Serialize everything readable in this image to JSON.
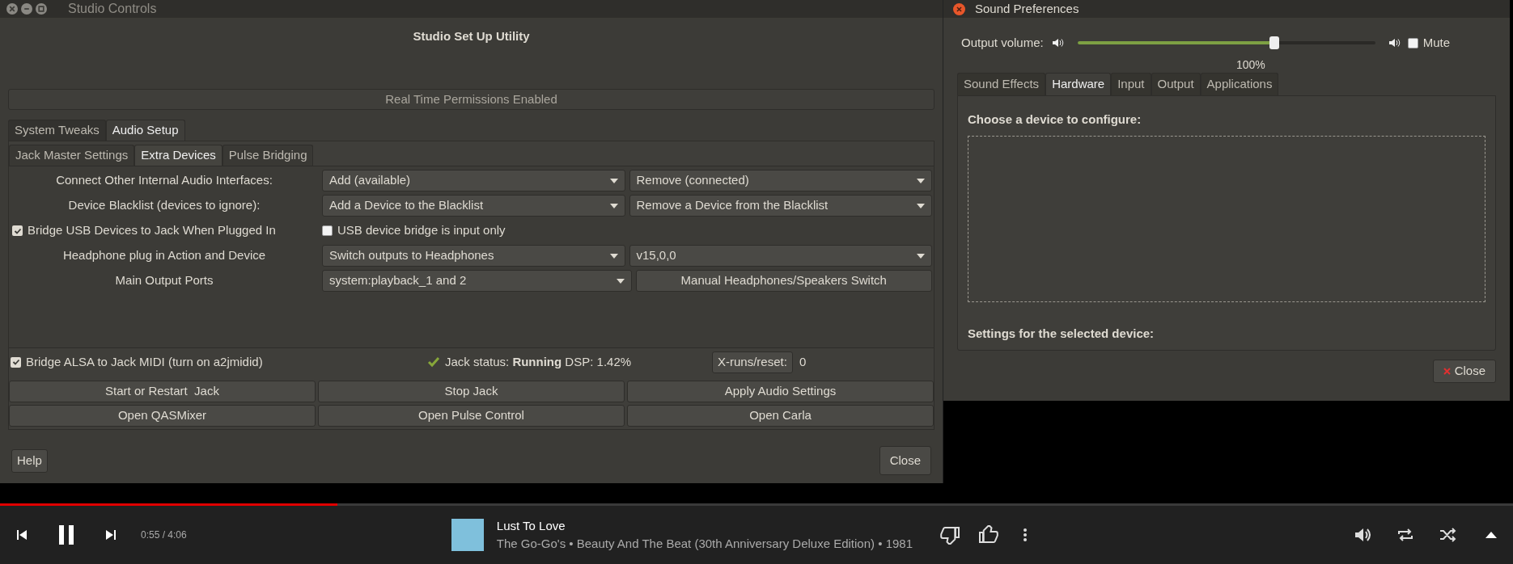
{
  "studio_window": {
    "title": "Studio Controls",
    "heading": "Studio Set Up Utility",
    "status_banner": "Real Time Permissions Enabled",
    "tabs": [
      {
        "label": "System Tweaks",
        "selected": false
      },
      {
        "label": "Audio Setup",
        "selected": true
      }
    ],
    "subtabs": [
      {
        "label": "Jack Master Settings",
        "selected": false
      },
      {
        "label": "Extra Devices",
        "selected": true
      },
      {
        "label": "Pulse Bridging",
        "selected": false
      }
    ],
    "rows": [
      {
        "kind": "combos",
        "label": "Connect Other Internal Audio Interfaces:",
        "combo_1": "Add (available)",
        "combo_2": "Remove (connected)"
      },
      {
        "kind": "combos",
        "label": "Device Blacklist (devices to ignore):",
        "combo_1": "Add a Device to the Blacklist",
        "combo_2": "Remove a Device from the Blacklist"
      },
      {
        "kind": "checks",
        "check_1": {
          "label": "Bridge USB Devices to Jack When Plugged In",
          "checked": true
        },
        "check_2": {
          "label": "USB device bridge is input only",
          "checked": false
        }
      },
      {
        "kind": "combos",
        "label": "Headphone plug in Action and Device",
        "combo_1": "Switch outputs to Headphones",
        "combo_2": "v15,0,0"
      },
      {
        "kind": "combo_button",
        "label": "Main Output Ports",
        "combo_1": "system:playback_1 and 2",
        "button": "Manual Headphones/Speakers Switch"
      }
    ],
    "midi_bridge": {
      "label": "Bridge ALSA to Jack MIDI (turn on a2jmidid)",
      "checked": true
    },
    "jack_status": {
      "label": "Jack status:",
      "state": "Running",
      "dsp": "DSP: 1.42%"
    },
    "xruns": {
      "button": "X-runs/reset:",
      "count": "0"
    },
    "actions": [
      "Start or Restart  Jack",
      "Stop Jack",
      "Apply Audio Settings",
      "Open QASMixer",
      "Open Pulse Control",
      "Open Carla"
    ],
    "help_button": "Help",
    "close_button": "Close"
  },
  "sound_window": {
    "title": "Sound Preferences",
    "volume_label": "Output volume:",
    "volume": {
      "level": 0.66,
      "reading": "100%"
    },
    "mute": {
      "label": "Mute",
      "checked": false
    },
    "tabs": [
      {
        "label": "Sound Effects",
        "selected": false
      },
      {
        "label": "Hardware",
        "selected": true
      },
      {
        "label": "Input",
        "selected": false
      },
      {
        "label": "Output",
        "selected": false
      },
      {
        "label": "Applications",
        "selected": false
      }
    ],
    "device_heading": "Choose a device to configure:",
    "settings_heading": "Settings for the selected device:",
    "close_button": "Close"
  },
  "player": {
    "progress": {
      "level": 0.223
    },
    "time": "0:55 / 4:06",
    "title": "Lust To Love",
    "subtitle": "The Go-Go's • Beauty And The Beat (30th Anniversary Deluxe Edition) • 1981"
  }
}
